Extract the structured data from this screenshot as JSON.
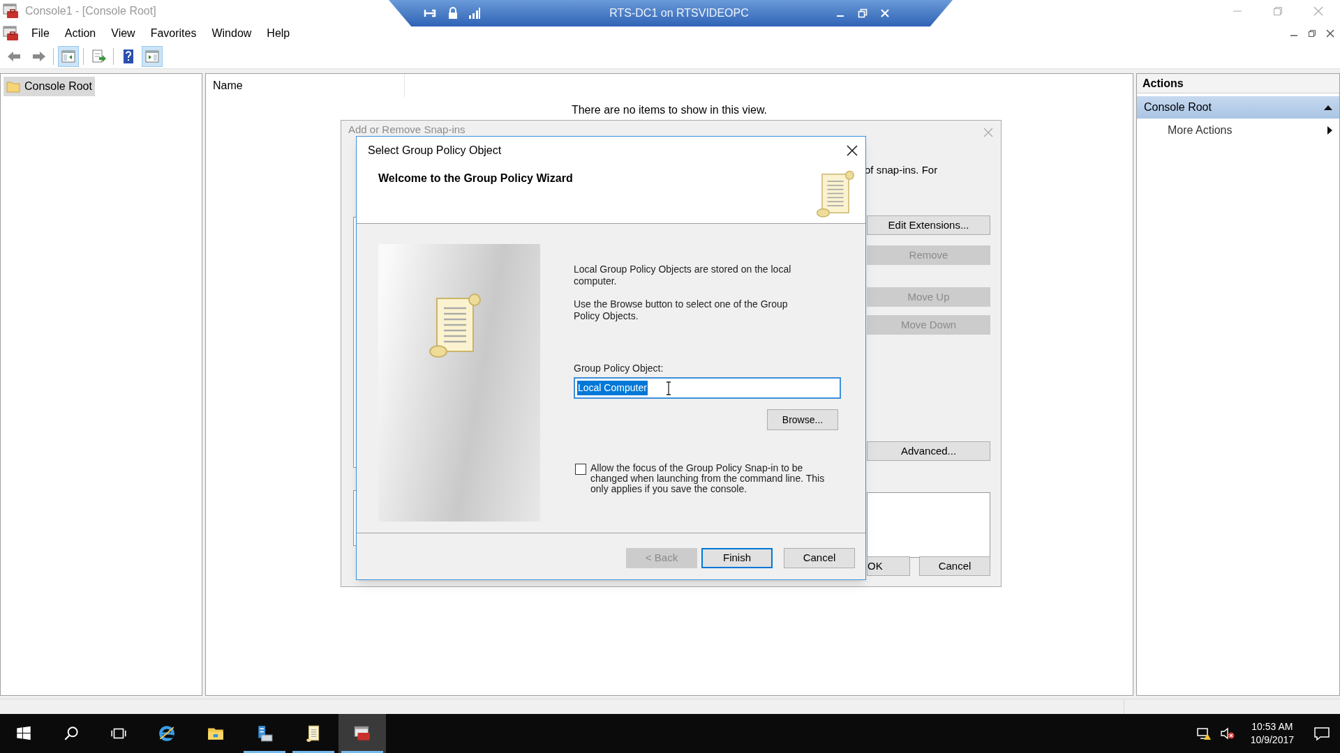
{
  "window": {
    "title": "Console1 - [Console Root]"
  },
  "remote_bar": {
    "title": "RTS-DC1 on RTSVIDEOPC"
  },
  "menu": [
    "File",
    "Action",
    "View",
    "Favorites",
    "Window",
    "Help"
  ],
  "toolbar": [
    {
      "kind": "back",
      "selected": false
    },
    {
      "kind": "forward",
      "selected": false
    },
    {
      "kind": "tree",
      "selected": true
    },
    {
      "kind": "export",
      "selected": false
    },
    {
      "kind": "help",
      "selected": false
    },
    {
      "kind": "actionpane",
      "selected": true
    }
  ],
  "tree": [
    {
      "label": "Console Root",
      "selected": true
    }
  ],
  "list": {
    "columns": [
      "Name"
    ],
    "empty_message": "There are no items to show in this view."
  },
  "actions": {
    "title": "Actions",
    "sections": [
      {
        "label": "Console Root",
        "expanded": true,
        "items": [
          {
            "label": "More Actions"
          }
        ]
      }
    ]
  },
  "snapin_dialog": {
    "title": "Add or Remove Snap-ins",
    "intro": "of snap-ins. For",
    "side_buttons": [
      {
        "label": "Edit Extensions...",
        "disabled": false
      },
      {
        "label": "Remove",
        "disabled": true
      },
      {
        "label": "Move Up",
        "disabled": true
      },
      {
        "label": "Move Down",
        "disabled": true
      },
      {
        "label": "Advanced...",
        "disabled": false
      }
    ],
    "footer_buttons": [
      {
        "label": "OK"
      },
      {
        "label": "Cancel"
      }
    ]
  },
  "wizard": {
    "title": "Select Group Policy Object",
    "heading": "Welcome to the Group Policy Wizard",
    "paragraphs": [
      "Local Group Policy Objects are stored on the local computer.",
      "Use the Browse button to select one of the Group Policy Objects."
    ],
    "field": {
      "label": "Group Policy Object:",
      "value": "Local Computer",
      "text_selected": true
    },
    "browse": "Browse...",
    "checkbox": {
      "label": "Allow the focus of the Group Policy Snap-in to be changed when launching from the command line.  This only applies if you save the console.",
      "checked": false
    },
    "buttons": [
      {
        "label": "< Back",
        "disabled": true,
        "default": false
      },
      {
        "label": "Finish",
        "disabled": false,
        "default": true
      },
      {
        "label": "Cancel",
        "disabled": false,
        "default": false
      }
    ]
  },
  "taskbar": {
    "apps": [
      {
        "kind": "start",
        "open": false,
        "selected": false
      },
      {
        "kind": "search",
        "open": false,
        "selected": false
      },
      {
        "kind": "taskview",
        "open": false,
        "selected": false
      },
      {
        "kind": "browser",
        "open": false,
        "selected": false
      },
      {
        "kind": "folder",
        "open": false,
        "selected": false
      },
      {
        "kind": "server",
        "open": true,
        "selected": false
      },
      {
        "kind": "scroll",
        "open": true,
        "selected": false
      },
      {
        "kind": "console",
        "open": true,
        "selected": true
      }
    ],
    "clock": {
      "time": "10:53 AM",
      "date": "10/9/2017"
    }
  }
}
